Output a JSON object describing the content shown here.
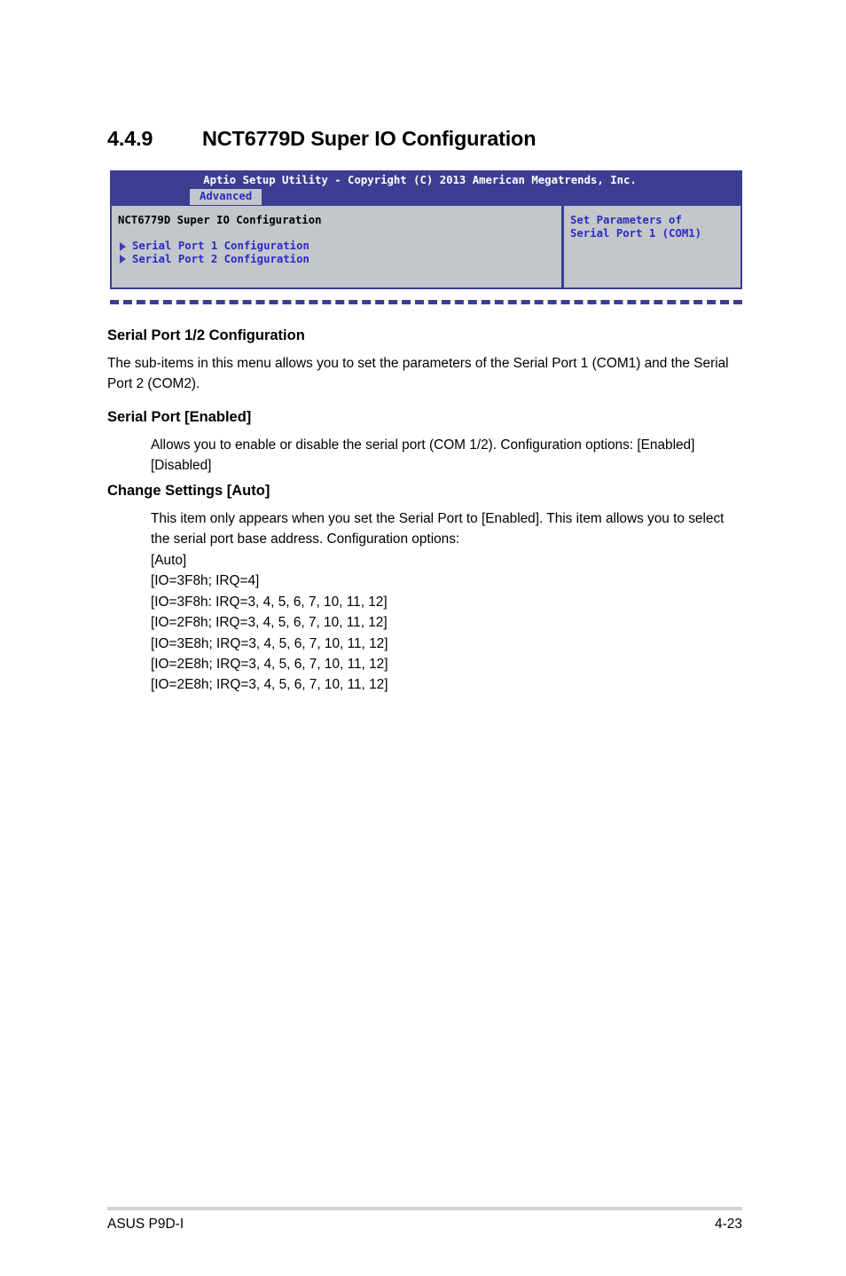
{
  "section": {
    "number": "4.4.9",
    "title": "NCT6779D Super IO Configuration"
  },
  "bios": {
    "titlebar": "Aptio Setup Utility - Copyright (C) 2013 American Megatrends, Inc.",
    "tab": "Advanced",
    "screen_heading": "NCT6779D Super IO Configuration",
    "items": [
      {
        "label": "Serial Port 1 Configuration",
        "icon": "triangle-right-icon"
      },
      {
        "label": "Serial Port 2 Configuration",
        "icon": "triangle-right-icon"
      }
    ],
    "help": {
      "line1": "Set Parameters of",
      "line2": "Serial Port 1 (COM1)"
    },
    "colors": {
      "titlebar_blue": "#3c3e92",
      "panel_gray": "#c3c6cb",
      "link_blue": "#2b2bc4"
    }
  },
  "content": {
    "serial_port_12": {
      "heading": "Serial Port 1/2 Configuration",
      "body": "The sub-items in this menu allows you to set the parameters of the Serial Port 1 (COM1) and the Serial Port 2 (COM2)."
    },
    "serial_port": {
      "heading": "Serial Port [Enabled]",
      "body": "Allows you to enable or disable the serial port (COM 1/2). Configuration options: [Enabled] [Disabled]"
    },
    "change_settings": {
      "heading": "Change Settings [Auto]",
      "body": "This item only appears when you set the Serial Port to [Enabled]. This item allows you to select the serial port base address. Configuration options:",
      "options": [
        "[Auto]",
        "[IO=3F8h; IRQ=4]",
        "[IO=3F8h: IRQ=3, 4, 5, 6, 7, 10, 11, 12]",
        "[IO=2F8h; IRQ=3, 4, 5, 6, 7, 10, 11, 12]",
        "[IO=3E8h; IRQ=3, 4, 5, 6, 7, 10, 11, 12]",
        "[IO=2E8h; IRQ=3, 4, 5, 6, 7, 10, 11, 12]",
        "[IO=2E8h; IRQ=3, 4, 5, 6, 7, 10, 11, 12]"
      ]
    }
  },
  "footer": {
    "left": "ASUS P9D-I",
    "right": "4-23"
  }
}
